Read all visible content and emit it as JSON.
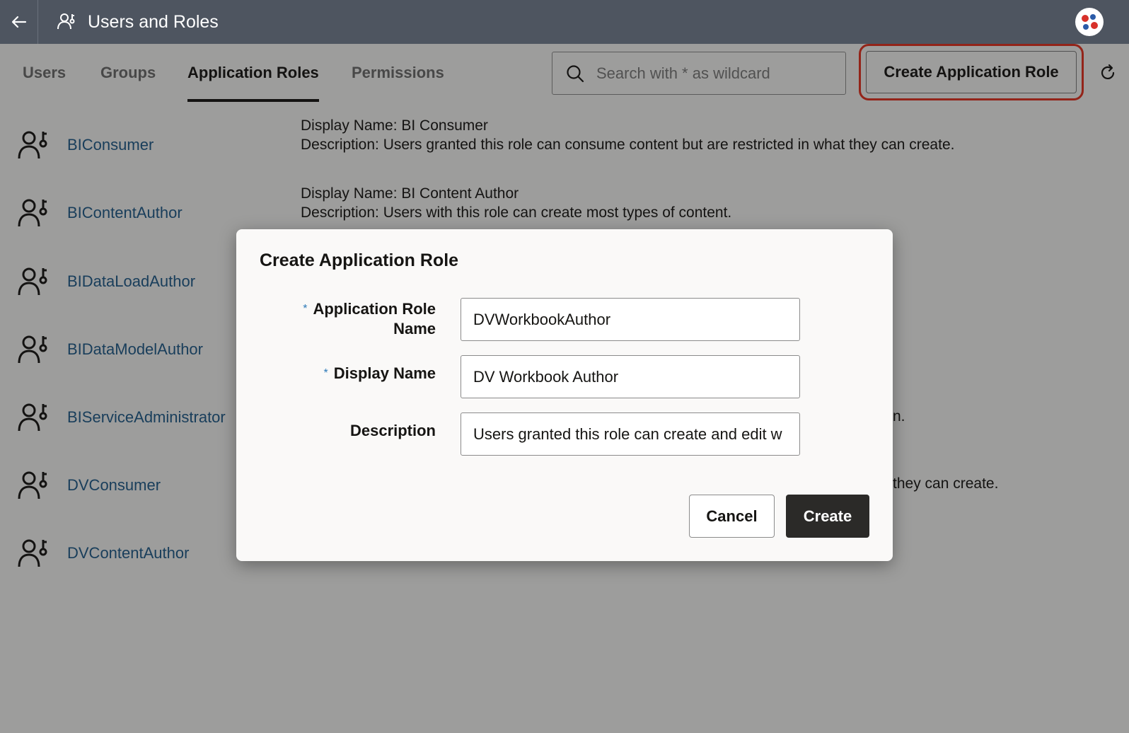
{
  "header": {
    "title": "Users and Roles"
  },
  "tabs": [
    {
      "label": "Users"
    },
    {
      "label": "Groups"
    },
    {
      "label": "Application Roles"
    },
    {
      "label": "Permissions"
    }
  ],
  "search": {
    "placeholder": "Search with * as wildcard"
  },
  "toolbar": {
    "create_label": "Create Application Role"
  },
  "roles": [
    {
      "name": "BIConsumer",
      "display": "Display Name: BI Consumer",
      "description": "Description: Users granted this role can consume content but are restricted in what they can create."
    },
    {
      "name": "BIContentAuthor",
      "display": "Display Name: BI Content Author",
      "description": "Description: Users with this role can create most types of content."
    },
    {
      "name": "BIDataLoadAuthor"
    },
    {
      "name": "BIDataModelAuthor"
    },
    {
      "name": "BIServiceAdministrator",
      "tail": "n."
    },
    {
      "name": "DVConsumer",
      "tail": "they can create."
    },
    {
      "name": "DVContentAuthor"
    }
  ],
  "dialog": {
    "title": "Create Application Role",
    "role_name_label": "Application Role Name",
    "role_name_value": "DVWorkbookAuthor",
    "display_name_label": "Display Name",
    "display_name_value": "DV Workbook Author",
    "description_label": "Description",
    "description_value": "Users granted this role can create and edit w",
    "required_mark": "*",
    "cancel_label": "Cancel",
    "create_label": "Create"
  },
  "colors": {
    "header_bg": "#4e5560",
    "link": "#1e5a8a",
    "highlight": "#e5301e",
    "primary_button": "#2b2a28"
  }
}
